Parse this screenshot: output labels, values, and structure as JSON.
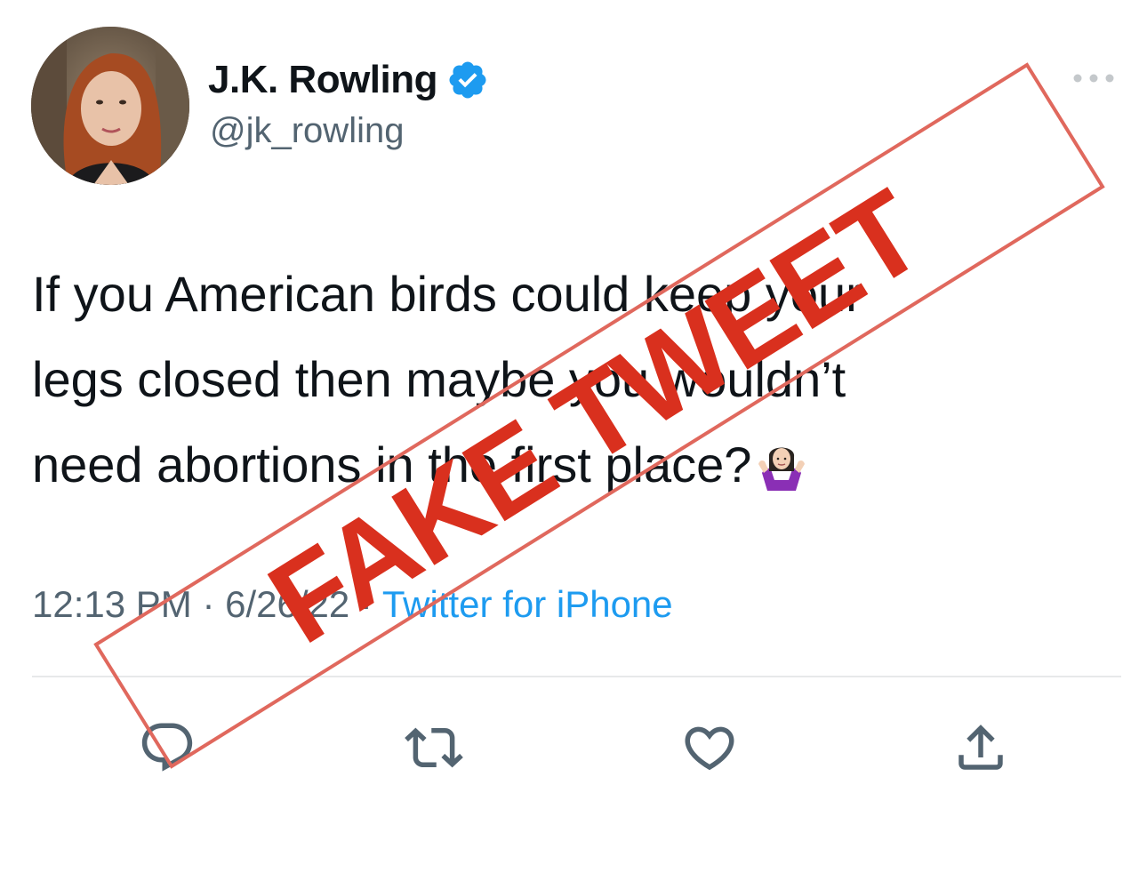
{
  "user": {
    "display_name": "J.K. Rowling",
    "handle": "@jk_rowling",
    "verified": true,
    "avatar_icon": "profile-photo"
  },
  "tweet": {
    "line1": "If you American birds could keep your",
    "line2": "legs closed then maybe you wouldn’t",
    "line3": "need abortions in the first place?",
    "emoji": "person-shrugging-emoji",
    "time": "12:13 PM",
    "separator": " · ",
    "date": "6/26/22",
    "source": "Twitter for iPhone"
  },
  "actions": {
    "reply_icon": "reply-icon",
    "retweet_icon": "retweet-icon",
    "like_icon": "heart-icon",
    "share_icon": "share-icon"
  },
  "stamp": {
    "text": "FAKE TWEET",
    "color": "#d9301e",
    "border_color": "#e0685d"
  },
  "colors": {
    "verified_blue": "#1d9bf0",
    "link_blue": "#1d9bf0",
    "secondary_text": "#536471",
    "icon_gray": "#536471"
  }
}
